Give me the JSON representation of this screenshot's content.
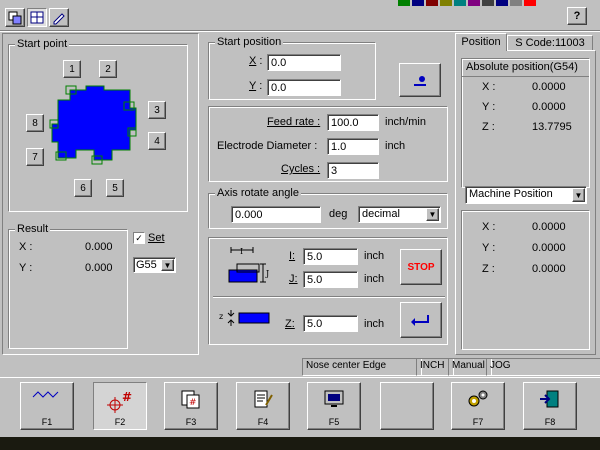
{
  "toolbar": {
    "help_label": "?",
    "icons": [
      "layers-icon",
      "grid-icon",
      "edit-icon"
    ]
  },
  "start_point": {
    "title": "Start point",
    "points": [
      "1",
      "2",
      "3",
      "4",
      "5",
      "6",
      "7",
      "8"
    ]
  },
  "result": {
    "title": "Result",
    "x_label": "X :",
    "x_value": "0.000",
    "y_label": "Y :",
    "y_value": "0.000",
    "set_label": "Set",
    "set_checked": true,
    "coord_system": "G55"
  },
  "start_position": {
    "title": "Start position",
    "x_label": "X",
    "x_value": "0.0",
    "y_label": "Y",
    "y_value": "0.0"
  },
  "params": {
    "feed_rate_label": "Feed rate :",
    "feed_rate_value": "100.0",
    "feed_rate_unit": "inch/min",
    "electrode_label": "Electrode Diameter :",
    "electrode_value": "1.0",
    "electrode_unit": "inch",
    "cycles_label": "Cycles :",
    "cycles_value": "3"
  },
  "axis": {
    "title": "Axis rotate angle",
    "value": "0.000",
    "unit": "deg",
    "mode": "decimal"
  },
  "ij": {
    "i_label": "I:",
    "i_value": "5.0",
    "i_unit": "inch",
    "j_label": "J:",
    "j_value": "5.0",
    "j_unit": "inch",
    "stop_label": "STOP",
    "z_label": "Z:",
    "z_value": "5.0",
    "z_unit": "inch"
  },
  "right_panel": {
    "tab_position": "Position",
    "tab_scode": "S Code:11003",
    "abs_title": "Absolute position(G54)",
    "abs": [
      {
        "axis": "X :",
        "value": "0.0000"
      },
      {
        "axis": "Y :",
        "value": "0.0000"
      },
      {
        "axis": "Z :",
        "value": "13.7795"
      }
    ],
    "machine_select": "Machine Position",
    "machine": [
      {
        "axis": "X :",
        "value": "0.0000"
      },
      {
        "axis": "Y :",
        "value": "0.0000"
      },
      {
        "axis": "Z :",
        "value": "0.0000"
      }
    ]
  },
  "status": {
    "mode": "Nose center Edge",
    "unit": "INCH",
    "control": "Manual",
    "jog": "JOG"
  },
  "fkeys": [
    "F1",
    "F2",
    "F3",
    "F4",
    "F5",
    "",
    "F7",
    "F8"
  ],
  "colors": {
    "face": "#c0c0c0",
    "electrode_blue": "#0000ff",
    "stop_red": "#ff0000",
    "outline_green": "#008000"
  }
}
